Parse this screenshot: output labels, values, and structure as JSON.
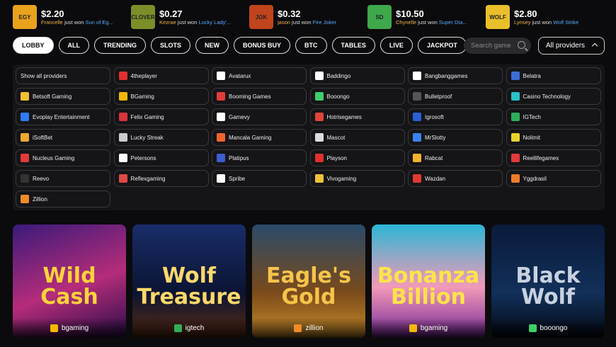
{
  "wins": [
    {
      "amount": "$2.20",
      "user": "Francelle",
      "text": "just won",
      "game": "Sun of Eg...",
      "color": "#e8a21c",
      "thumb": "EGY"
    },
    {
      "amount": "$0.27",
      "user": "Kezrae",
      "text": "just won",
      "game": "Lucky Lady'...",
      "color": "#7a8f2a",
      "thumb": "CLOVER"
    },
    {
      "amount": "$0.32",
      "user": "jason",
      "text": "just won",
      "game": "Fire Joker",
      "color": "#c0441c",
      "thumb": "JOK"
    },
    {
      "amount": "$10.50",
      "user": "Chynelle",
      "text": "just won",
      "game": "Super Dia...",
      "color": "#3fa84b",
      "thumb": "SD"
    },
    {
      "amount": "$2.80",
      "user": "Lynsey",
      "text": "just won",
      "game": "Wolf Strike",
      "color": "#e9c02b",
      "thumb": "WOLF"
    }
  ],
  "tabs": [
    "LOBBY",
    "ALL",
    "TRENDING",
    "SLOTS",
    "NEW",
    "BONUS BUY",
    "BTC",
    "TABLES",
    "LIVE",
    "JACKPOT"
  ],
  "search": {
    "placeholder": "Search game"
  },
  "providers_button": "All providers",
  "providers": [
    {
      "label": "Show all providers",
      "color": ""
    },
    {
      "label": "4theplayer",
      "color": "#e03030"
    },
    {
      "label": "Avatarux",
      "color": "#ffffff"
    },
    {
      "label": "Baddingo",
      "color": "#ffffff"
    },
    {
      "label": "Bangbanggames",
      "color": "#ffffff"
    },
    {
      "label": "Belatra",
      "color": "#3b6fd6"
    },
    {
      "label": "Betsoft Gaming",
      "color": "#f2c12e"
    },
    {
      "label": "BGaming",
      "color": "#f5b800"
    },
    {
      "label": "Booming Games",
      "color": "#e23b3b"
    },
    {
      "label": "Booongo",
      "color": "#3ccf6a"
    },
    {
      "label": "Bulletproof",
      "color": "#555555"
    },
    {
      "label": "Casino Technology",
      "color": "#27c3c9"
    },
    {
      "label": "Evoplay Entertainment",
      "color": "#2f7cf6"
    },
    {
      "label": "Felix Gaming",
      "color": "#d8343a"
    },
    {
      "label": "Gamevy",
      "color": "#ffffff"
    },
    {
      "label": "Hotrisegames",
      "color": "#e0443a"
    },
    {
      "label": "Igrosoft",
      "color": "#2b5fd3"
    },
    {
      "label": "IGTech",
      "color": "#2fae5a"
    },
    {
      "label": "iSoftBet",
      "color": "#f0a830"
    },
    {
      "label": "Lucky Streak",
      "color": "#cccccc"
    },
    {
      "label": "Mancala Gaming",
      "color": "#f0622d"
    },
    {
      "label": "Mascot",
      "color": "#dddddd"
    },
    {
      "label": "MrSlotty",
      "color": "#3b83f0"
    },
    {
      "label": "Nolimit",
      "color": "#e8d42a"
    },
    {
      "label": "Nucleus Gaming",
      "color": "#e23b3b"
    },
    {
      "label": "Petersons",
      "color": "#ffffff"
    },
    {
      "label": "Platipus",
      "color": "#3a5dd0"
    },
    {
      "label": "Playson",
      "color": "#e0312e"
    },
    {
      "label": "Rabcat",
      "color": "#f3b32a"
    },
    {
      "label": "Reellifegames",
      "color": "#e23b3b"
    },
    {
      "label": "Reevo",
      "color": "#333333"
    },
    {
      "label": "Reflexgaming",
      "color": "#e04848"
    },
    {
      "label": "Spribe",
      "color": "#ffffff"
    },
    {
      "label": "Vivogaming",
      "color": "#f0c23a"
    },
    {
      "label": "Wazdan",
      "color": "#e2392f"
    },
    {
      "label": "Yggdrasil",
      "color": "#f07a2a"
    },
    {
      "label": "Zillion",
      "color": "#f08b2a"
    }
  ],
  "games": [
    {
      "title": "Wild Cash",
      "provider": "bgaming",
      "bg": "linear-gradient(160deg,#3a1a7a,#b52c7a 55%,#2a0d4a)",
      "color": "#ffd23a",
      "logo": "#f5b800"
    },
    {
      "title": "Wolf Treasure",
      "provider": "igtech",
      "bg": "linear-gradient(180deg,#1a2d6a,#0b1433 60%,#5a2a12)",
      "color": "#ffd86a",
      "logo": "#2fae5a"
    },
    {
      "title": "Eagle's Gold",
      "provider": "zillion",
      "bg": "linear-gradient(180deg,#2a4a6a,#7a4a1a 60%,#c98c2a)",
      "color": "#f6c44a",
      "logo": "#f08b2a"
    },
    {
      "title": "Bonanza Billion",
      "provider": "bgaming",
      "bg": "linear-gradient(180deg,#2bb6d6,#f29ab8 55%,#7a2a9a)",
      "color": "#ffe34a",
      "logo": "#f5b800"
    },
    {
      "title": "Black Wolf",
      "provider": "booongo",
      "bg": "linear-gradient(180deg,#0a1a3a,#12305a 60%,#050a16)",
      "color": "#c9d2e0",
      "logo": "#3ccf6a"
    }
  ]
}
